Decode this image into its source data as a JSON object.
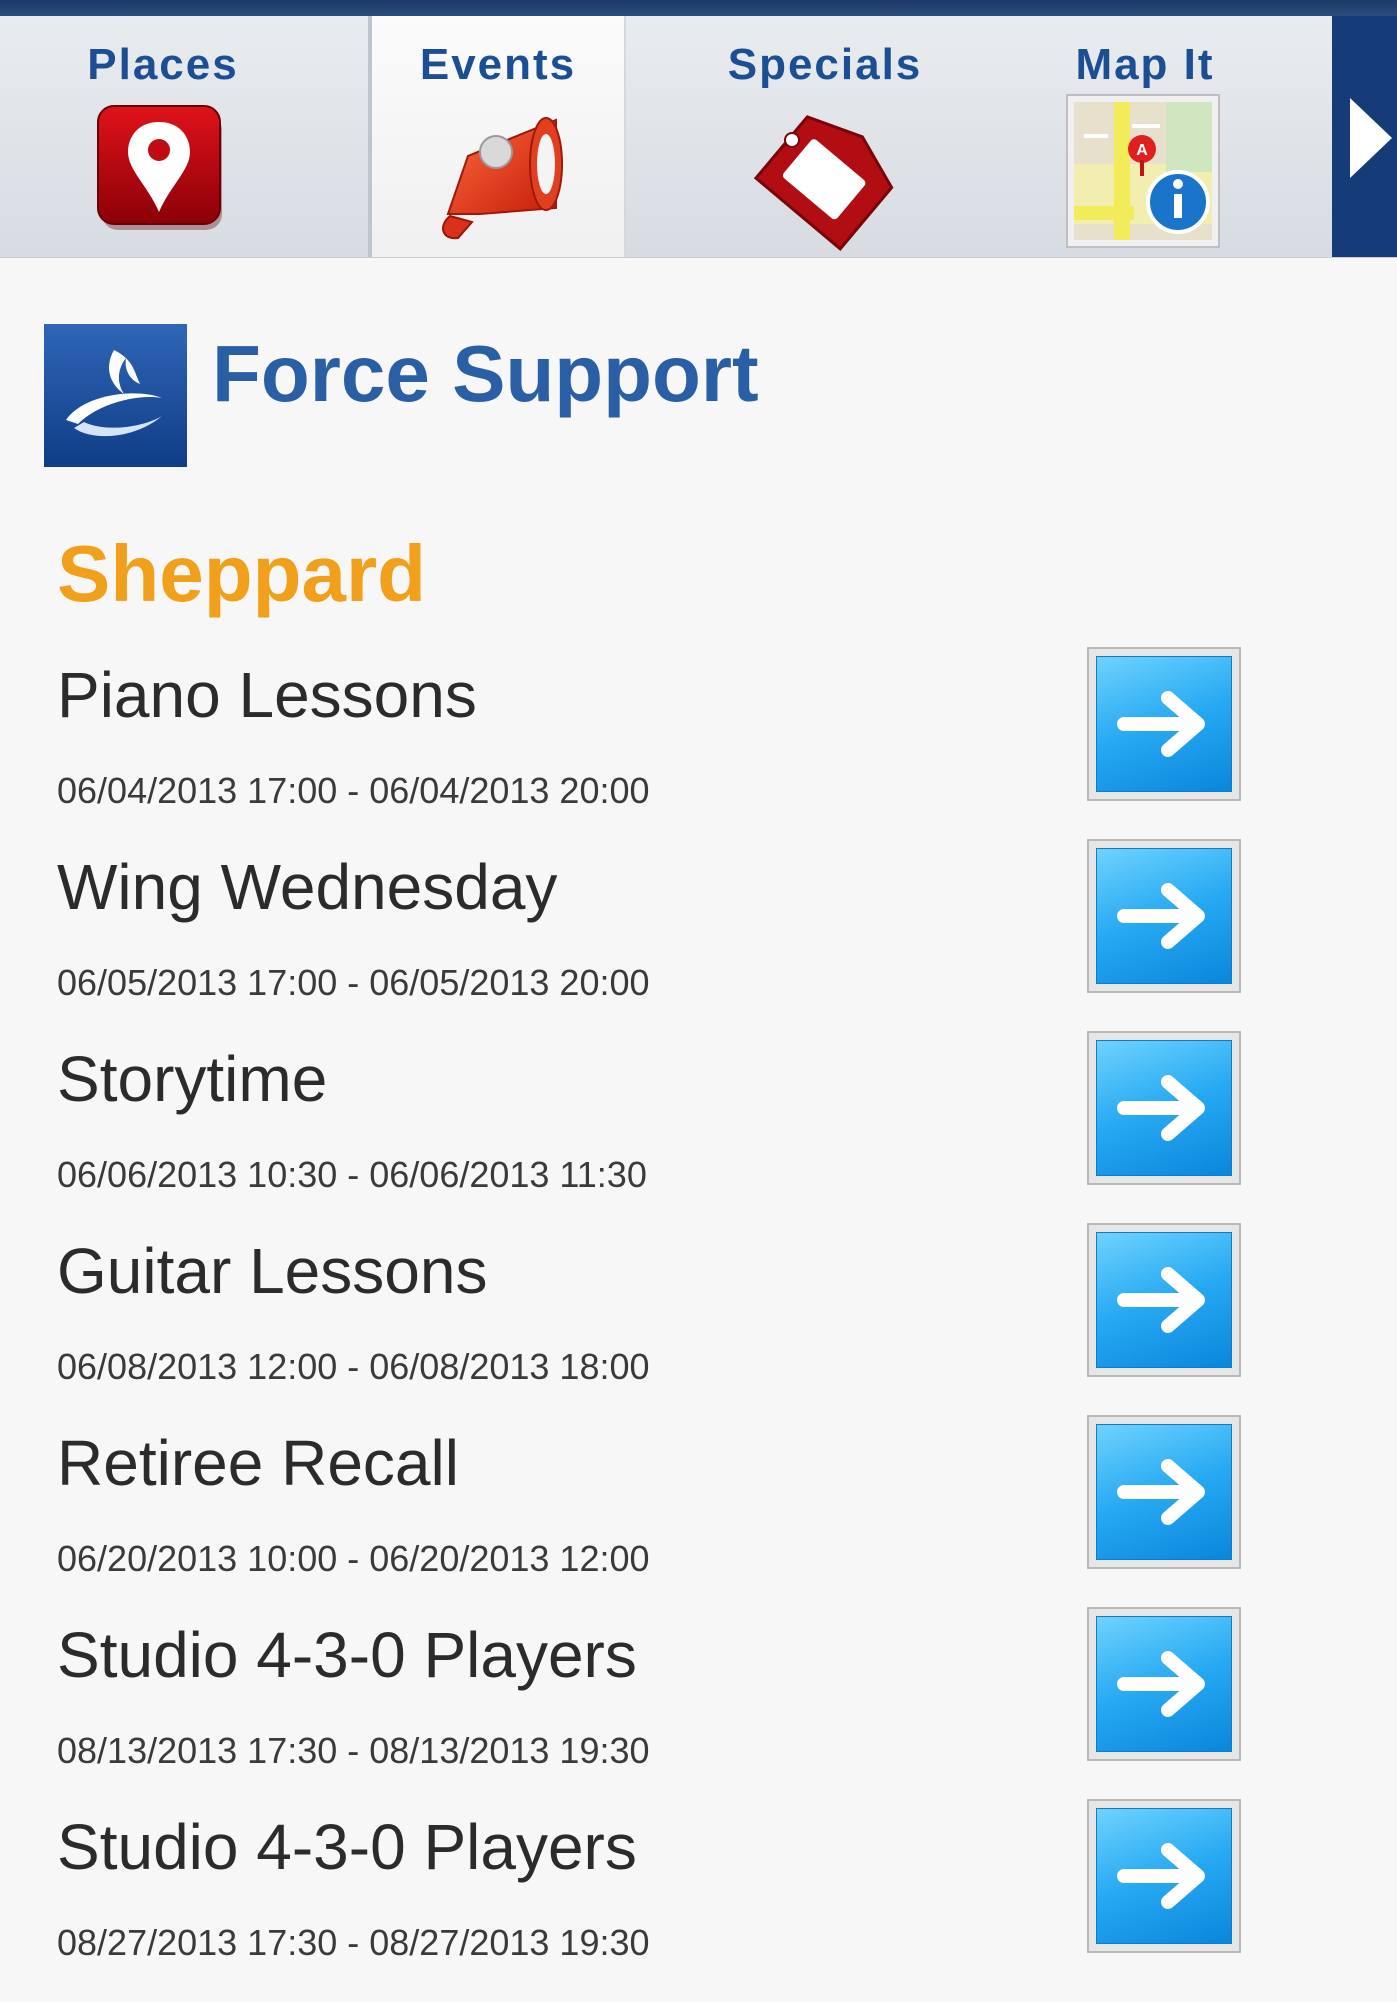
{
  "tabs": [
    {
      "label": "Places",
      "icon": "map-pin-icon"
    },
    {
      "label": "Events",
      "icon": "megaphone-icon",
      "selected": true
    },
    {
      "label": "Specials",
      "icon": "price-tag-icon"
    },
    {
      "label": "Map It",
      "icon": "map-info-icon"
    }
  ],
  "more_icon": "right-triangle-icon",
  "header": {
    "title": "Force Support",
    "logo_icon": "force-support-logo"
  },
  "section": {
    "title": "Sheppard"
  },
  "events": [
    {
      "name": "Piano Lessons",
      "time": "06/04/2013 17:00 - 06/04/2013 20:00"
    },
    {
      "name": "Wing Wednesday",
      "time": "06/05/2013 17:00 - 06/05/2013 20:00"
    },
    {
      "name": "Storytime",
      "time": "06/06/2013 10:30 - 06/06/2013 11:30"
    },
    {
      "name": "Guitar Lessons",
      "time": "06/08/2013 12:00 - 06/08/2013 18:00"
    },
    {
      "name": "Retiree Recall",
      "time": "06/20/2013 10:00 - 06/20/2013 12:00"
    },
    {
      "name": "Studio 4-3-0 Players",
      "time": "08/13/2013 17:30 - 08/13/2013 19:30"
    },
    {
      "name": "Studio 4-3-0 Players",
      "time": "08/27/2013 17:30 - 08/27/2013 19:30"
    }
  ],
  "colors": {
    "tab_label": "#1b4e93",
    "header_title": "#2b5fa5",
    "section_title": "#f0a01a",
    "arrow_button": "#26a9f2"
  }
}
